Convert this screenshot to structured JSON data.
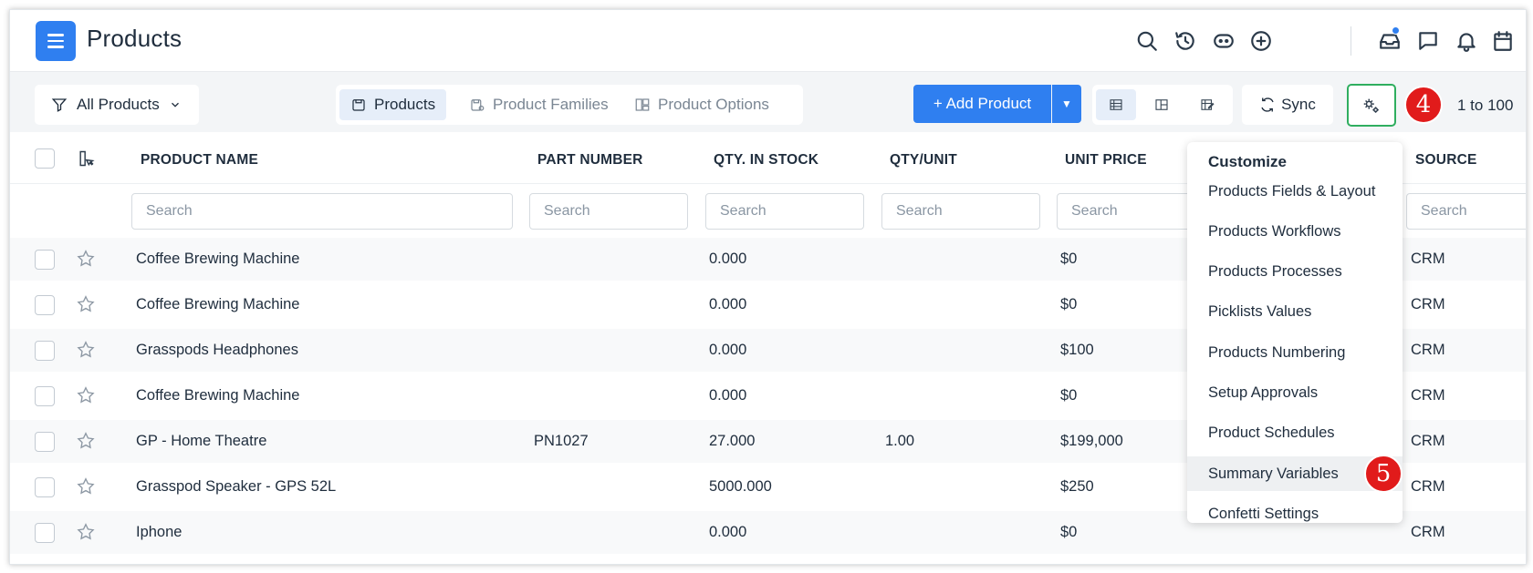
{
  "header": {
    "title": "Products",
    "icons": [
      "search-icon",
      "history-icon",
      "bot-icon",
      "plus-circle-icon",
      "inbox-icon",
      "chat-icon",
      "bell-icon",
      "calendar-icon"
    ]
  },
  "toolbar": {
    "filter_label": "All Products",
    "tabs": [
      {
        "label": "Products",
        "icon": "product-icon",
        "active": true
      },
      {
        "label": "Product Families",
        "icon": "families-icon",
        "active": false
      },
      {
        "label": "Product Options",
        "icon": "options-icon",
        "active": false
      }
    ],
    "add_label": "+ Add Product",
    "sync_label": "Sync",
    "pager": "1 to 100",
    "badge_4": "4"
  },
  "table": {
    "columns": [
      "PRODUCT NAME",
      "PART NUMBER",
      "QTY. IN STOCK",
      "QTY/UNIT",
      "UNIT PRICE",
      "SOURCE"
    ],
    "search_placeholder": "Search",
    "rows": [
      {
        "name": "Coffee Brewing Machine",
        "part": "",
        "qty": "0.000",
        "unit": "",
        "price": "$0",
        "source": "CRM"
      },
      {
        "name": "Coffee Brewing Machine",
        "part": "",
        "qty": "0.000",
        "unit": "",
        "price": "$0",
        "source": "CRM"
      },
      {
        "name": "Grasspods Headphones",
        "part": "",
        "qty": "0.000",
        "unit": "",
        "price": "$100",
        "source": "CRM"
      },
      {
        "name": "Coffee Brewing Machine",
        "part": "",
        "qty": "0.000",
        "unit": "",
        "price": "$0",
        "source": "CRM"
      },
      {
        "name": "GP - Home Theatre",
        "part": "PN1027",
        "qty": "27.000",
        "unit": "1.00",
        "price": "$199,000",
        "source": "CRM"
      },
      {
        "name": "Grasspod Speaker - GPS 52L",
        "part": "",
        "qty": "5000.000",
        "unit": "",
        "price": "$250",
        "source": "CRM"
      },
      {
        "name": "Iphone",
        "part": "",
        "qty": "0.000",
        "unit": "",
        "price": "$0",
        "source": "CRM"
      }
    ]
  },
  "customize_menu": {
    "title": "Customize",
    "items": [
      "Products Fields & Layout",
      "Products Workflows",
      "Products Processes",
      "Picklists Values",
      "Products Numbering",
      "Setup Approvals",
      "Product Schedules",
      "Summary Variables",
      "Confetti Settings"
    ],
    "highlighted": "Summary Variables",
    "badge_5": "5"
  },
  "colors": {
    "accent": "#2f7ff0",
    "badge": "#e11b1b",
    "settings_border": "#2fae5f"
  }
}
